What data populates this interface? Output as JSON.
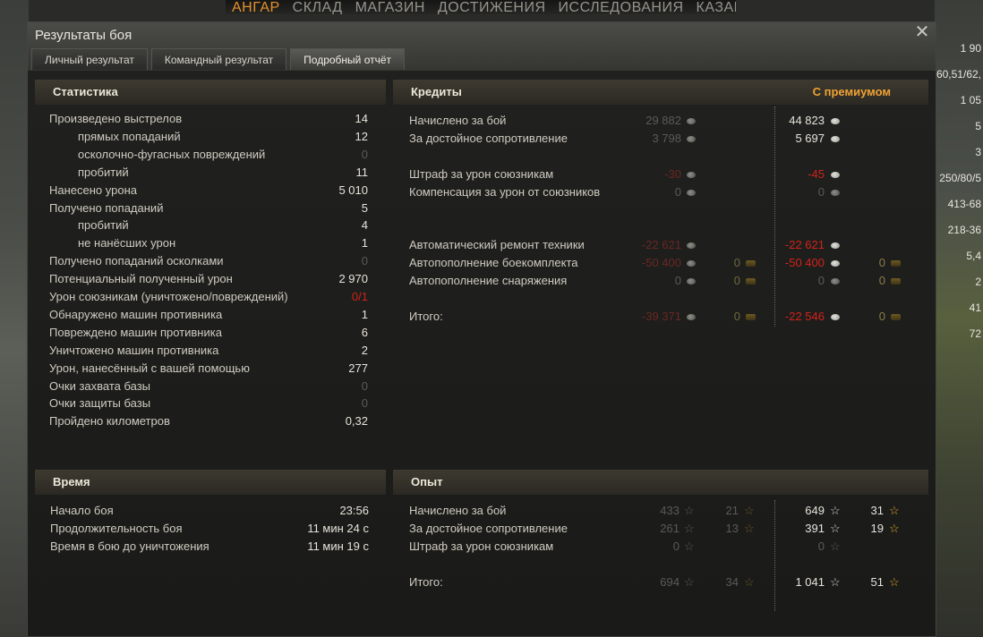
{
  "topnav": {
    "items": [
      "АНГАР",
      "СКЛАД",
      "МАГАЗИН",
      "ДОСТИЖЕНИЯ",
      "ИССЛЕДОВАНИЯ",
      "КАЗАРМА"
    ],
    "active": "АНГАР"
  },
  "background_right": [
    "1 90",
    "60,51/62,",
    "1 05",
    "5",
    "3",
    "250/80/5",
    "413-68",
    "218-36",
    "5,4",
    "2",
    "41",
    "72"
  ],
  "dialog": {
    "title": "Результаты боя",
    "close_symbol": "✕",
    "tabs": [
      "Личный результат",
      "Командный результат",
      "Подробный отчёт"
    ],
    "active_tab": 2
  },
  "statistics": {
    "title": "Статистика",
    "rows": [
      {
        "label": "Произведено выстрелов",
        "value": "14",
        "indent": false,
        "style": "normal"
      },
      {
        "label": "прямых попаданий",
        "value": "12",
        "indent": true,
        "style": "normal"
      },
      {
        "label": "осколочно-фугасных повреждений",
        "value": "0",
        "indent": true,
        "style": "dim"
      },
      {
        "label": "пробитий",
        "value": "11",
        "indent": true,
        "style": "normal"
      },
      {
        "label": "Нанесено урона",
        "value": "5 010",
        "indent": false,
        "style": "normal"
      },
      {
        "label": "Получено попаданий",
        "value": "5",
        "indent": false,
        "style": "normal"
      },
      {
        "label": "пробитий",
        "value": "4",
        "indent": true,
        "style": "normal"
      },
      {
        "label": "не нанёсших урон",
        "value": "1",
        "indent": true,
        "style": "normal"
      },
      {
        "label": "Получено попаданий осколками",
        "value": "0",
        "indent": false,
        "style": "dim"
      },
      {
        "label": "Потенциальный полученный урон",
        "value": "2 970",
        "indent": false,
        "style": "normal"
      },
      {
        "label": "Урон союзникам (уничтожено/повреждений)",
        "value": "0/1",
        "indent": false,
        "style": "red"
      },
      {
        "label": "Обнаружено машин противника",
        "value": "1",
        "indent": false,
        "style": "normal"
      },
      {
        "label": "Повреждено машин противника",
        "value": "6",
        "indent": false,
        "style": "normal"
      },
      {
        "label": "Уничтожено машин противника",
        "value": "2",
        "indent": false,
        "style": "normal"
      },
      {
        "label": "Урон, нанесённый с вашей помощью",
        "value": "277",
        "indent": false,
        "style": "normal"
      },
      {
        "label": "Очки захвата базы",
        "value": "0",
        "indent": false,
        "style": "dim"
      },
      {
        "label": "Очки защиты базы",
        "value": "0",
        "indent": false,
        "style": "dim"
      },
      {
        "label": "Пройдено километров",
        "value": "0,32",
        "indent": false,
        "style": "normal"
      }
    ]
  },
  "credits": {
    "title": "Кредиты",
    "premium_label": "С премиумом",
    "rows": [
      {
        "label": "Начислено за бой",
        "base": "29 882",
        "base_style": "dim",
        "base_gold": "",
        "prem": "44 823",
        "prem_style": "normal",
        "prem_gold": ""
      },
      {
        "label": "За достойное сопротивление",
        "base": "3 798",
        "base_style": "dim",
        "base_gold": "",
        "prem": "5 697",
        "prem_style": "normal",
        "prem_gold": ""
      },
      {
        "label": "",
        "base": "",
        "base_style": "dim",
        "base_gold": "",
        "prem": "",
        "prem_style": "normal",
        "prem_gold": ""
      },
      {
        "label": "Штраф за урон союзникам",
        "base": "-30",
        "base_style": "dimred",
        "base_gold": "",
        "prem": "-45",
        "prem_style": "red",
        "prem_gold": ""
      },
      {
        "label": "Компенсация за урон от союзников",
        "base": "0",
        "base_style": "dim",
        "base_gold": "",
        "prem": "0",
        "prem_style": "dim",
        "prem_gold": ""
      },
      {
        "label": "",
        "base": "",
        "base_style": "dim",
        "base_gold": "",
        "prem": "",
        "prem_style": "normal",
        "prem_gold": ""
      },
      {
        "label": "",
        "base": "",
        "base_style": "dim",
        "base_gold": "",
        "prem": "",
        "prem_style": "normal",
        "prem_gold": ""
      },
      {
        "label": "Автоматический ремонт техники",
        "base": "-22 621",
        "base_style": "dimred",
        "base_gold": "",
        "prem": "-22 621",
        "prem_style": "red",
        "prem_gold": ""
      },
      {
        "label": "Автопополнение боекомплекта",
        "base": "-50 400",
        "base_style": "dimred",
        "base_gold": "0",
        "prem": "-50 400",
        "prem_style": "red",
        "prem_gold": "0"
      },
      {
        "label": "Автопополнение снаряжения",
        "base": "0",
        "base_style": "dim",
        "base_gold": "0",
        "prem": "0",
        "prem_style": "dim",
        "prem_gold": "0"
      },
      {
        "label": "",
        "base": "",
        "base_style": "dim",
        "base_gold": "",
        "prem": "",
        "prem_style": "normal",
        "prem_gold": ""
      },
      {
        "label": "Итого:",
        "base": "-39 371",
        "base_style": "dimred",
        "base_gold": "0",
        "prem": "-22 546",
        "prem_style": "red",
        "prem_gold": "0"
      }
    ]
  },
  "time": {
    "title": "Время",
    "rows": [
      {
        "label": "Начало боя",
        "value": "23:56"
      },
      {
        "label": "Продолжительность боя",
        "value": "11 мин 24 с"
      },
      {
        "label": "Время в бою до уничтожения",
        "value": "11 мин 19 с"
      }
    ]
  },
  "experience": {
    "title": "Опыт",
    "rows": [
      {
        "label": "Начислено за бой",
        "xp": "433",
        "free": "21",
        "prem_xp": "649",
        "prem_free": "31",
        "prem_xp_style": "normal"
      },
      {
        "label": "За достойное сопротивление",
        "xp": "261",
        "free": "13",
        "prem_xp": "391",
        "prem_free": "19",
        "prem_xp_style": "normal"
      },
      {
        "label": "Штраф за урон союзникам",
        "xp": "0",
        "free": "",
        "prem_xp": "0",
        "prem_free": "",
        "prem_xp_style": "dim"
      },
      {
        "label": "",
        "xp": "",
        "free": "",
        "prem_xp": "",
        "prem_free": "",
        "prem_xp_style": "normal"
      },
      {
        "label": "Итого:",
        "xp": "694",
        "free": "34",
        "prem_xp": "1 041",
        "prem_free": "51",
        "prem_xp_style": "normal"
      }
    ]
  },
  "icons": {
    "credit": "silver-coin-icon",
    "gold": "gold-bar-icon",
    "xp": "star-icon",
    "free_xp": "gold-star-icon",
    "close": "close-icon"
  },
  "colors": {
    "accent_orange": "#f0a234",
    "penalty_red": "#d2231a",
    "header_bg": "#3e3a30"
  }
}
